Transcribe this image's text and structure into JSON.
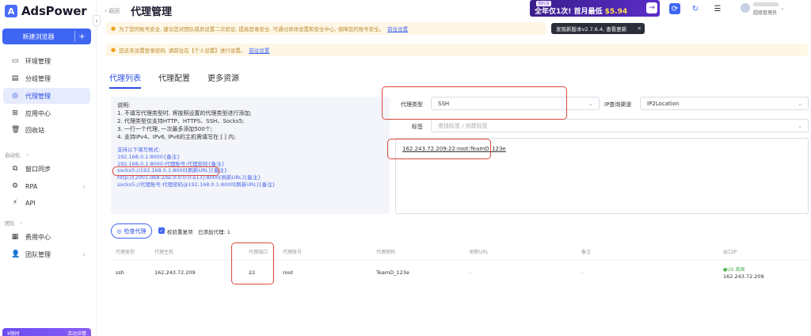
{
  "sidebar": {
    "brand": "AdsPower",
    "brand_mark": "A",
    "collapse": "‹",
    "new_browser": "新建浏览器",
    "new_browser_plus": "+",
    "items": [
      {
        "label": "环境管理",
        "icon": "▭"
      },
      {
        "label": "分组管理",
        "icon": "▤"
      },
      {
        "label": "代理管理",
        "icon": "◎"
      },
      {
        "label": "应用中心",
        "icon": "⊞"
      },
      {
        "label": "回收站",
        "icon": "🗑"
      },
      {
        "label": "窗口同步",
        "icon": "⧉"
      },
      {
        "label": "RPA",
        "icon": "⚙"
      },
      {
        "label": "API",
        "icon": "⚡"
      },
      {
        "label": "费用中心",
        "icon": "▦"
      },
      {
        "label": "团队管理",
        "icon": "👤"
      }
    ],
    "sections": {
      "automation": "自动化",
      "team": "团队"
    },
    "chev_right": "›",
    "chev_down": "⌄",
    "promo_left": "¥限时",
    "promo_right": "活动详情"
  },
  "header": {
    "back": "‹ 返回",
    "title": "代理管理",
    "promo_tag": "限时促",
    "promo_text": "全年仅1次! 首月最低 ",
    "promo_price": "$5.94",
    "promo_arrow": "→",
    "icons": [
      "sync-icon",
      "refresh-icon",
      "list-icon",
      "bell-icon"
    ],
    "user_role": "超级管理员",
    "user_chev": "⌄",
    "update_tip": "发现新版本v2.7.6.4, 查看更新",
    "update_close": "✕"
  },
  "notices": [
    {
      "text": "为了您的账号安全, 建议您对团队成员设置二次验证, 提高登录安全, 可通过修改设置和安全中心, 保障您的账号安全。",
      "link": "前往设置"
    },
    {
      "text": "您还未设置登录密码, 请前往在【个人设置】进行设置。",
      "link": "前往设置"
    }
  ],
  "tabs": [
    "代理列表",
    "代理配置",
    "更多资源"
  ],
  "instructions": {
    "lines": [
      "说明:",
      "1. 不填写代理类型时, 将按照设置的代理类型进行添加;",
      "2. 代理类型仅支持HTTP、HTTPS、SSH、Socks5;",
      "3. 一行一个代理, 一次最多添加500个;",
      "4. 支持IPv4、IPv6, IPv6的主机需填写在 [ ] 内;"
    ],
    "formats_title": "支持以下填写格式:",
    "formats": [
      "192.168.0.1:8000{备注}",
      "192.168.0.1:8000:代理账号:代理密码{备注}",
      "socks5://192.168.0.1:8000[刷新URL]{备注}",
      "http://[2001:db8:2de:0:0:0:0:e13]:8000[刷新URL]{备注}",
      "socks5://代理账号:代理密码@192.168.0.1:8000[刷新URL]{备注}"
    ]
  },
  "form": {
    "proxy_type_label": "代理类型",
    "proxy_type_value": "SSH",
    "ip_channel_label": "IP查询渠道",
    "ip_channel_value": "IP2Location",
    "tags_label": "标签",
    "tags_placeholder": "查找标签 / 创建标签",
    "caret": "⌄",
    "proxy_text": "162.243.72.209:22:root:TeamD_123e"
  },
  "check": {
    "button": "检查代理",
    "button_icon": "◎",
    "dedupe_label": "校验重复项",
    "added_label": "已添加代理: 1",
    "checkmark": "✓"
  },
  "table": {
    "headers": [
      "代理类型",
      "代理主机",
      "代理端口",
      "代理账号",
      "代理密码",
      "刷新URL",
      "备注",
      "出口IP"
    ],
    "row": {
      "type": "ssh",
      "host": "162.243.72.209",
      "port": "22",
      "account": "root",
      "password": "TeamD_123e",
      "refresh": "-",
      "note": "-",
      "exit_flag": "●US 美国",
      "exit_ip": "162.243.72.209"
    }
  }
}
